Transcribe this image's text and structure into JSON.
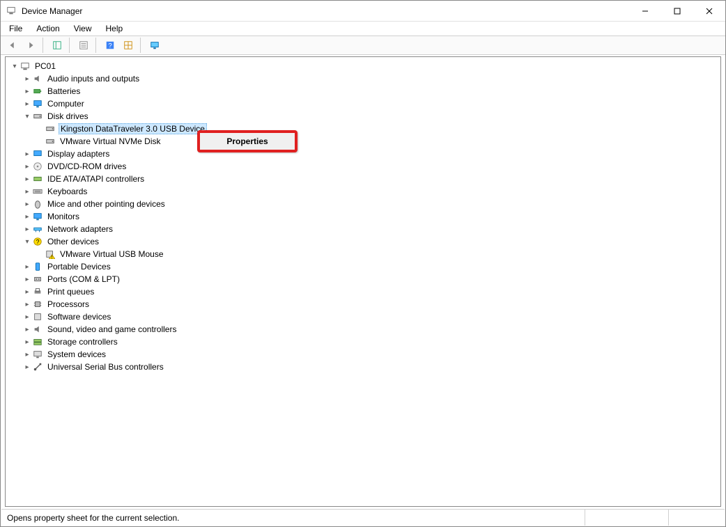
{
  "window": {
    "title": "Device Manager"
  },
  "menu": {
    "file": "File",
    "action": "Action",
    "view": "View",
    "help": "Help"
  },
  "tree": {
    "root": "PC01",
    "cat": {
      "audio": "Audio inputs and outputs",
      "batt": "Batteries",
      "comp": "Computer",
      "disk": "Disk drives",
      "disp": "Display adapters",
      "dvd": "DVD/CD-ROM drives",
      "ide": "IDE ATA/ATAPI controllers",
      "kb": "Keyboards",
      "mice": "Mice and other pointing devices",
      "mon": "Monitors",
      "net": "Network adapters",
      "other": "Other devices",
      "port": "Portable Devices",
      "ports": "Ports (COM & LPT)",
      "pq": "Print queues",
      "proc": "Processors",
      "swdev": "Software devices",
      "sound": "Sound, video and game controllers",
      "stor": "Storage controllers",
      "sys": "System devices",
      "usb": "Universal Serial Bus controllers"
    },
    "disk_children": {
      "d0": "Kingston DataTraveler 3.0 USB Device",
      "d1": "VMware Virtual NVMe Disk"
    },
    "other_children": {
      "o0": "VMware Virtual USB Mouse"
    }
  },
  "context": {
    "properties": "Properties"
  },
  "status": {
    "text": "Opens property sheet for the current selection."
  }
}
